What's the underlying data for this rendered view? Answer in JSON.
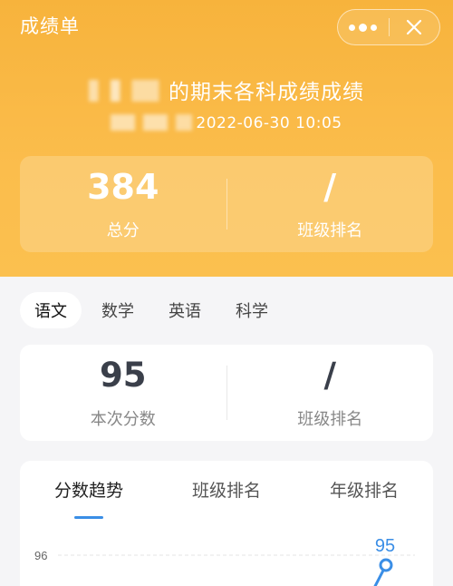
{
  "app": {
    "title": "成绩单"
  },
  "capsule": {
    "more_icon": "more-dots-icon",
    "close_icon": "close-icon"
  },
  "exam": {
    "title_suffix": "的期末各科成绩成绩",
    "datetime": "2022-06-30 10:05"
  },
  "summary": {
    "total_value": "384",
    "total_label": "总分",
    "rank_value": "/",
    "rank_label": "班级排名"
  },
  "subjects": {
    "tabs": [
      "语文",
      "数学",
      "英语",
      "科学"
    ],
    "active_index": 0
  },
  "subject_card": {
    "score_value": "95",
    "score_label": "本次分数",
    "rank_value": "/",
    "rank_label": "班级排名"
  },
  "chart_tabs": {
    "tabs": [
      "分数趋势",
      "班级排名",
      "年级排名"
    ],
    "active_index": 0
  },
  "colors": {
    "header": "#f7b33c",
    "accent": "#3a8ee6"
  },
  "chart_data": {
    "type": "line",
    "title": "",
    "xlabel": "",
    "ylabel": "",
    "y_ticks": [
      "96"
    ],
    "series": [
      {
        "values": [
          95
        ],
        "point_labels": [
          "95"
        ]
      }
    ]
  }
}
